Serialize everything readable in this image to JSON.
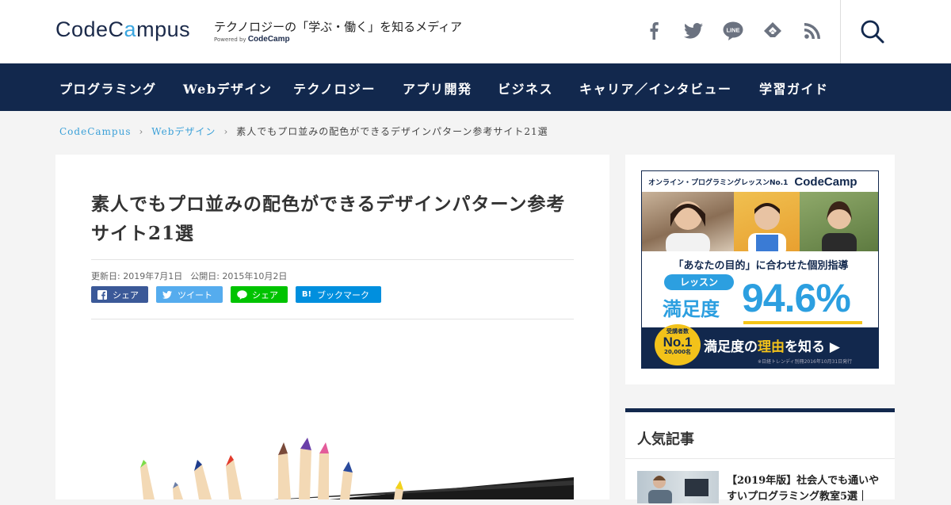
{
  "header": {
    "logo_prefix": "CodeC",
    "logo_a": "a",
    "logo_suffix": "mpus",
    "tagline": "テクノロジーの「学ぶ・働く」を知るメディア",
    "powered_by": "Powered by",
    "powered_brand": "CodeCamp",
    "social_icons": [
      "facebook-icon",
      "twitter-icon",
      "line-icon",
      "feedly-icon",
      "rss-icon"
    ],
    "line_label": "LINE"
  },
  "nav": {
    "items": [
      "プログラミング",
      "Webデザイン",
      "テクノロジー",
      "アプリ開発",
      "ビジネス",
      "キャリア／インタビュー",
      "学習ガイド"
    ]
  },
  "breadcrumb": {
    "home": "CodeCampus",
    "category": "Webデザイン",
    "current": "素人でもプロ並みの配色ができるデザインパターン参考サイト21選"
  },
  "article": {
    "title": "素人でもプロ並みの配色ができるデザインパターン参考サイト21選",
    "updated": "更新日: 2019年7月1日",
    "published": "公開日: 2015年10月2日",
    "share_buttons": [
      {
        "label": "シェア",
        "icon": "f",
        "color": "#3b5998"
      },
      {
        "label": "ツイート",
        "icon": "t",
        "color": "#55acee"
      },
      {
        "label": "シェア",
        "icon": "L",
        "color": "#00c300"
      },
      {
        "label": "ブックマーク",
        "icon": "B!",
        "color": "#008fde"
      }
    ]
  },
  "ad": {
    "top_text": "オンライン・プログラミングレッスンNo.1",
    "brand": "CodeCamp",
    "headline": "「あなたの目的」に合わせた個別指導",
    "pill": "レッスン",
    "satisfaction_label": "満足度",
    "satisfaction_value": "94.6%",
    "badge_top": "受講者数",
    "badge_no": "No.1",
    "badge_count": "20,000名",
    "cta_prefix": "満足度の",
    "cta_highlight": "理由",
    "cta_suffix": "を知る",
    "cta_arrow": "▶",
    "note": "※日経トレンディ別冊2016年10月31日発行"
  },
  "popular": {
    "title": "人気記事",
    "first_item": "【2019年版】社会人でも通いやすいプログラミング教室5選｜"
  },
  "colors": {
    "navy": "#12284d",
    "accent": "#3ba6e0",
    "link": "#3aa0d8"
  }
}
